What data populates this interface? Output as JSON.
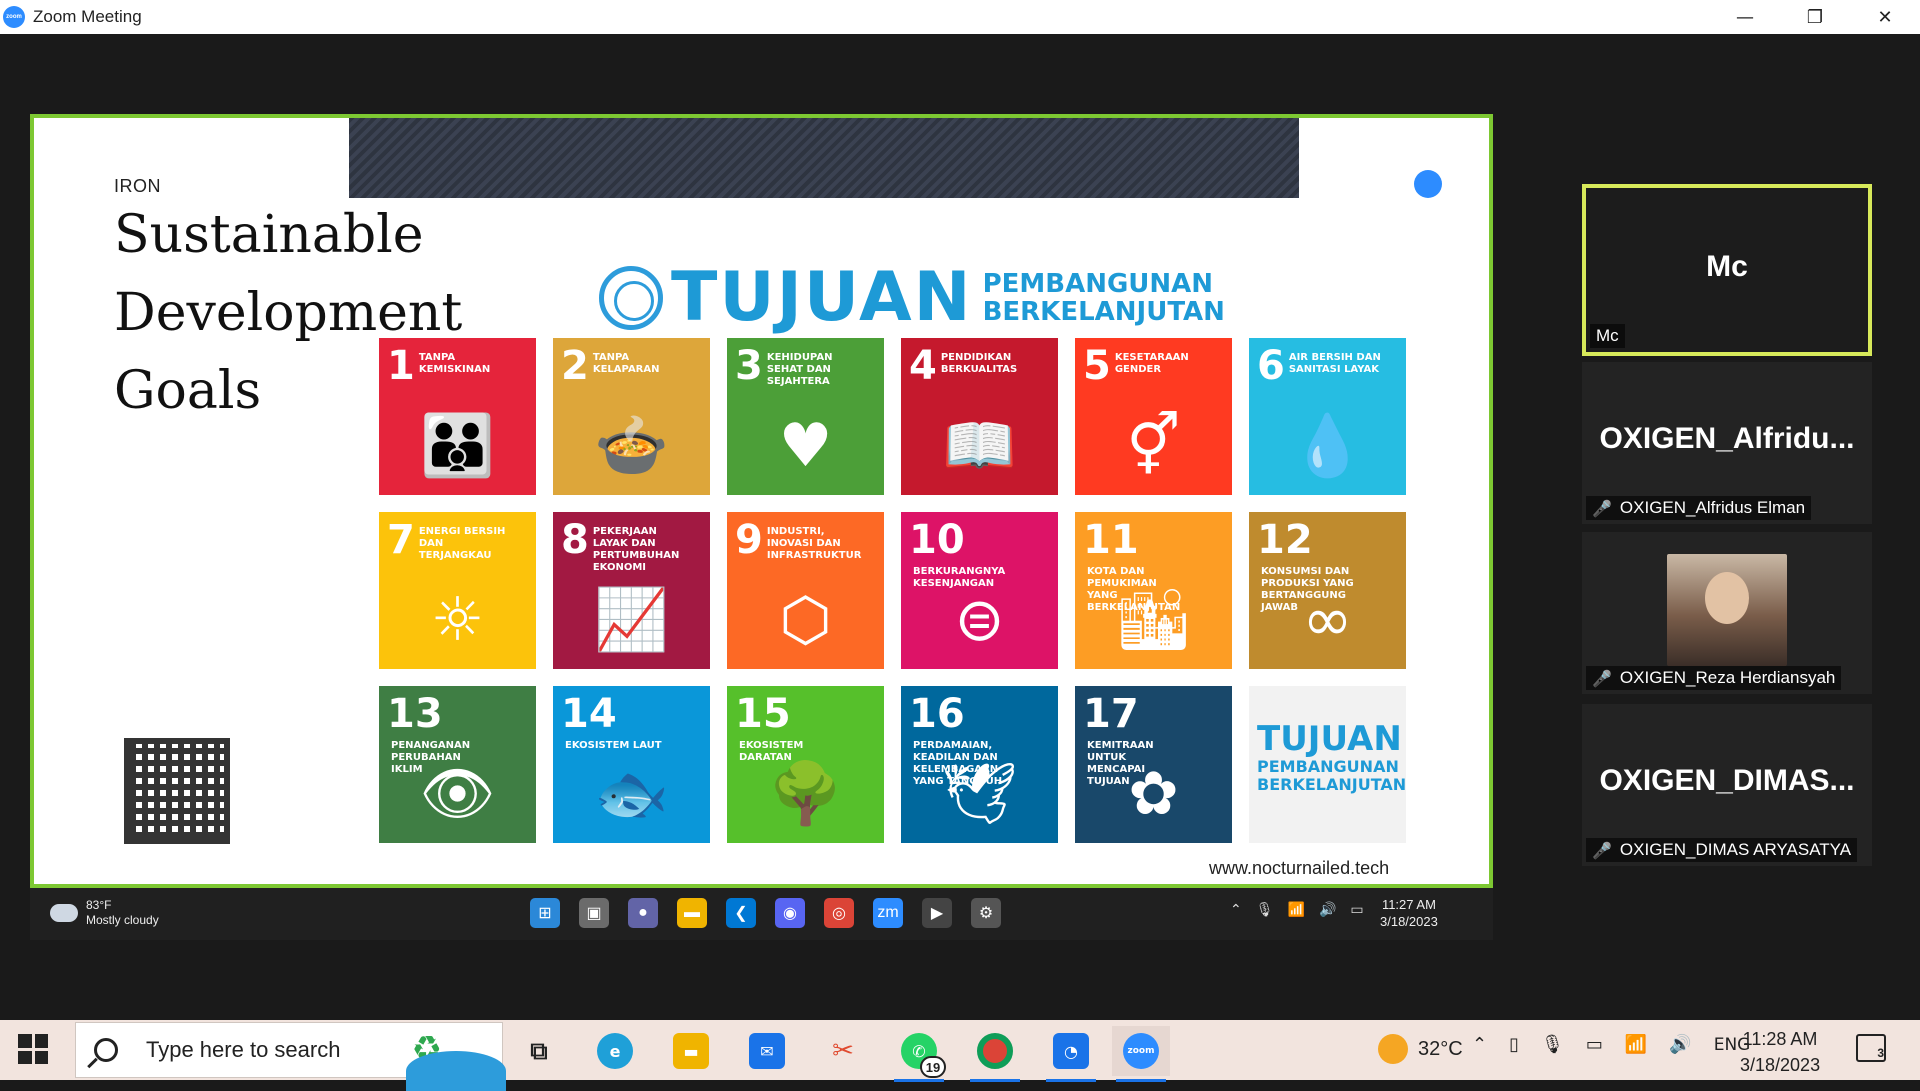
{
  "window": {
    "title": "Zoom Meeting",
    "minimize": "—",
    "restore": "❐",
    "close": "✕"
  },
  "slide": {
    "label": "IRON",
    "title_lines": [
      "Sustainable",
      "Development",
      "Goals"
    ],
    "header": {
      "main": "TUJUAN",
      "sub1": "PEMBANGUNAN",
      "sub2": "BERKELANJUTAN"
    },
    "url": "www.nocturnailed.tech",
    "goals": [
      {
        "num": "1",
        "label": "TANPA KEMISKINAN",
        "color": "#e5243b",
        "icon": "family-icon",
        "glyph": "👪"
      },
      {
        "num": "2",
        "label": "TANPA KELAPARAN",
        "color": "#dda63a",
        "icon": "bowl-icon",
        "glyph": "🍲"
      },
      {
        "num": "3",
        "label": "KEHIDUPAN SEHAT DAN SEJAHTERA",
        "color": "#4c9f38",
        "icon": "heartbeat-icon",
        "glyph": "♥"
      },
      {
        "num": "4",
        "label": "PENDIDIKAN BERKUALITAS",
        "color": "#c5192d",
        "icon": "book-icon",
        "glyph": "📖"
      },
      {
        "num": "5",
        "label": "KESETARAAN GENDER",
        "color": "#ff3a21",
        "icon": "gender-icon",
        "glyph": "⚥"
      },
      {
        "num": "6",
        "label": "AIR BERSIH DAN SANITASI LAYAK",
        "color": "#26bde2",
        "icon": "water-icon",
        "glyph": "💧"
      },
      {
        "num": "7",
        "label": "ENERGI BERSIH DAN TERJANGKAU",
        "color": "#fcc30b",
        "icon": "power-icon",
        "glyph": "☼"
      },
      {
        "num": "8",
        "label": "PEKERJAAN LAYAK DAN PERTUMBUHAN EKONOMI",
        "color": "#a21942",
        "icon": "growth-chart-icon",
        "glyph": "📈"
      },
      {
        "num": "9",
        "label": "INDUSTRI, INOVASI DAN INFRASTRUKTUR",
        "color": "#fd6925",
        "icon": "cubes-icon",
        "glyph": "⬡"
      },
      {
        "num": "10",
        "label": "BERKURANGNYA KESENJANGAN",
        "color": "#dd1367",
        "icon": "equal-icon",
        "glyph": "⊜"
      },
      {
        "num": "11",
        "label": "KOTA DAN PEMUKIMAN YANG BERKELANJUTAN",
        "color": "#fd9d24",
        "icon": "city-icon",
        "glyph": "🏙"
      },
      {
        "num": "12",
        "label": "KONSUMSI DAN PRODUKSI YANG BERTANGGUNG JAWAB",
        "color": "#bf8b2e",
        "icon": "infinity-icon",
        "glyph": "∞"
      },
      {
        "num": "13",
        "label": "PENANGANAN PERUBAHAN IKLIM",
        "color": "#3f7e44",
        "icon": "eye-earth-icon",
        "glyph": "👁"
      },
      {
        "num": "14",
        "label": "EKOSISTEM LAUT",
        "color": "#0a97d9",
        "icon": "fish-icon",
        "glyph": "🐟"
      },
      {
        "num": "15",
        "label": "EKOSISTEM DARATAN",
        "color": "#56c02b",
        "icon": "tree-icon",
        "glyph": "🌳"
      },
      {
        "num": "16",
        "label": "PERDAMAIAN, KEADILAN DAN KELEMBAGAAN YANG TANGGUH",
        "color": "#00689d",
        "icon": "dove-icon",
        "glyph": "🕊"
      },
      {
        "num": "17",
        "label": "KEMITRAAN UNTUK MENCAPAI TUJUAN",
        "color": "#19486a",
        "icon": "rings-icon",
        "glyph": "✿"
      }
    ],
    "logo_tile": {
      "t1": "TUJUAN",
      "t2": "PEMBANGUNAN",
      "t3": "BERKELANJUTAN"
    }
  },
  "inner_taskbar": {
    "weather_temp": "83°F",
    "weather_desc": "Mostly cloudy",
    "time": "11:27 AM",
    "date": "3/18/2023",
    "apps": [
      {
        "name": "windows-start-icon",
        "color": "#2b88d8",
        "glyph": "⊞"
      },
      {
        "name": "task-view-icon",
        "color": "#6b6b6b",
        "glyph": "▣"
      },
      {
        "name": "teams-chat-icon",
        "color": "#6264a7",
        "glyph": "●"
      },
      {
        "name": "file-explorer-icon",
        "color": "#f0b400",
        "glyph": "▬"
      },
      {
        "name": "vscode-icon",
        "color": "#0078d4",
        "glyph": "❮"
      },
      {
        "name": "discord-icon",
        "color": "#5865f2",
        "glyph": "◉"
      },
      {
        "name": "chrome-icon",
        "color": "#db4437",
        "glyph": "◎"
      },
      {
        "name": "zoom-icon",
        "color": "#2d8cff",
        "glyph": "zm"
      },
      {
        "name": "media-player-icon",
        "color": "#444",
        "glyph": "▶"
      },
      {
        "name": "settings-icon",
        "color": "#555",
        "glyph": "⚙"
      }
    ]
  },
  "participants": [
    {
      "display": "Mc",
      "label": "Mc",
      "muted": false,
      "speaking": true
    },
    {
      "display": "OXIGEN_Alfridu...",
      "label": "OXIGEN_Alfridus Elman",
      "muted": true
    },
    {
      "display": "",
      "label": "OXIGEN_Reza Herdiansyah",
      "muted": true,
      "video": true
    },
    {
      "display": "OXIGEN_DIMAS...",
      "label": "OXIGEN_DIMAS ARYASATYA",
      "muted": true
    }
  ],
  "taskbar": {
    "search_placeholder": "Type here to search",
    "whatsapp_badge": "19",
    "weather": "32°C",
    "lang": "ENG",
    "time": "11:28 AM",
    "date": "3/18/2023",
    "notifications": "3"
  }
}
